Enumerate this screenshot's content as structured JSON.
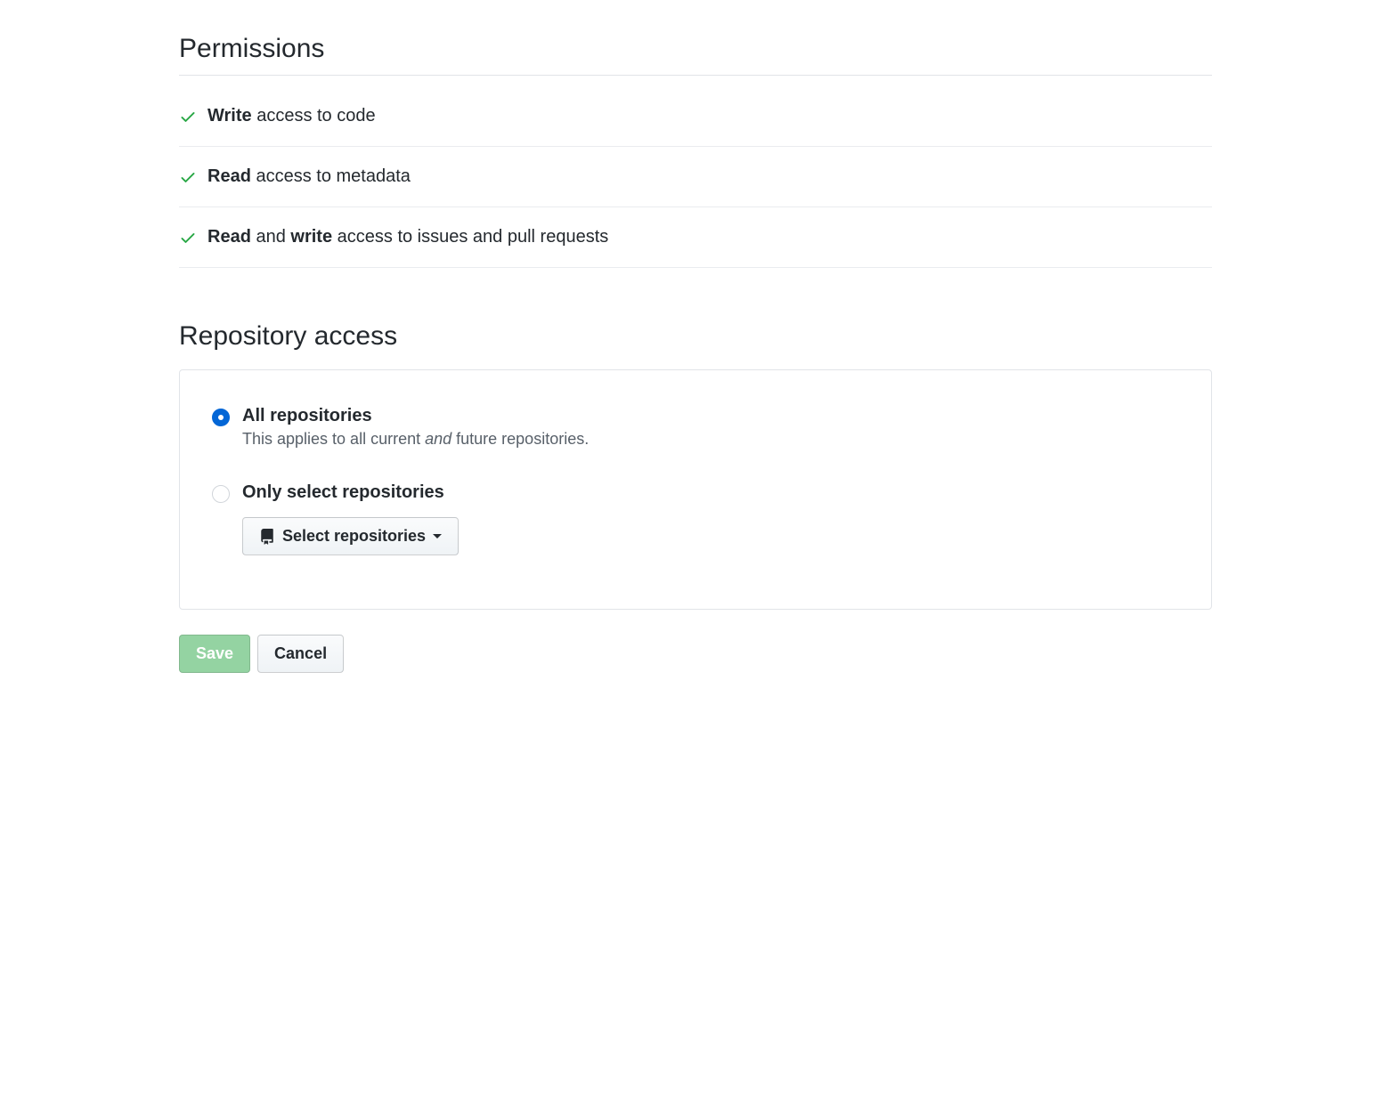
{
  "permissions": {
    "title": "Permissions",
    "items": [
      {
        "bold": "Write",
        "rest": " access to code"
      },
      {
        "bold": "Read",
        "rest": " access to metadata"
      },
      {
        "bold": "Read",
        "mid": " and ",
        "bold2": "write",
        "rest": " access to issues and pull requests"
      }
    ]
  },
  "repository_access": {
    "title": "Repository access",
    "all": {
      "label": "All repositories",
      "desc_pre": "This applies to all current ",
      "desc_em": "and",
      "desc_post": " future repositories."
    },
    "only": {
      "label": "Only select repositories",
      "select_button": "Select repositories"
    }
  },
  "actions": {
    "save": "Save",
    "cancel": "Cancel"
  }
}
